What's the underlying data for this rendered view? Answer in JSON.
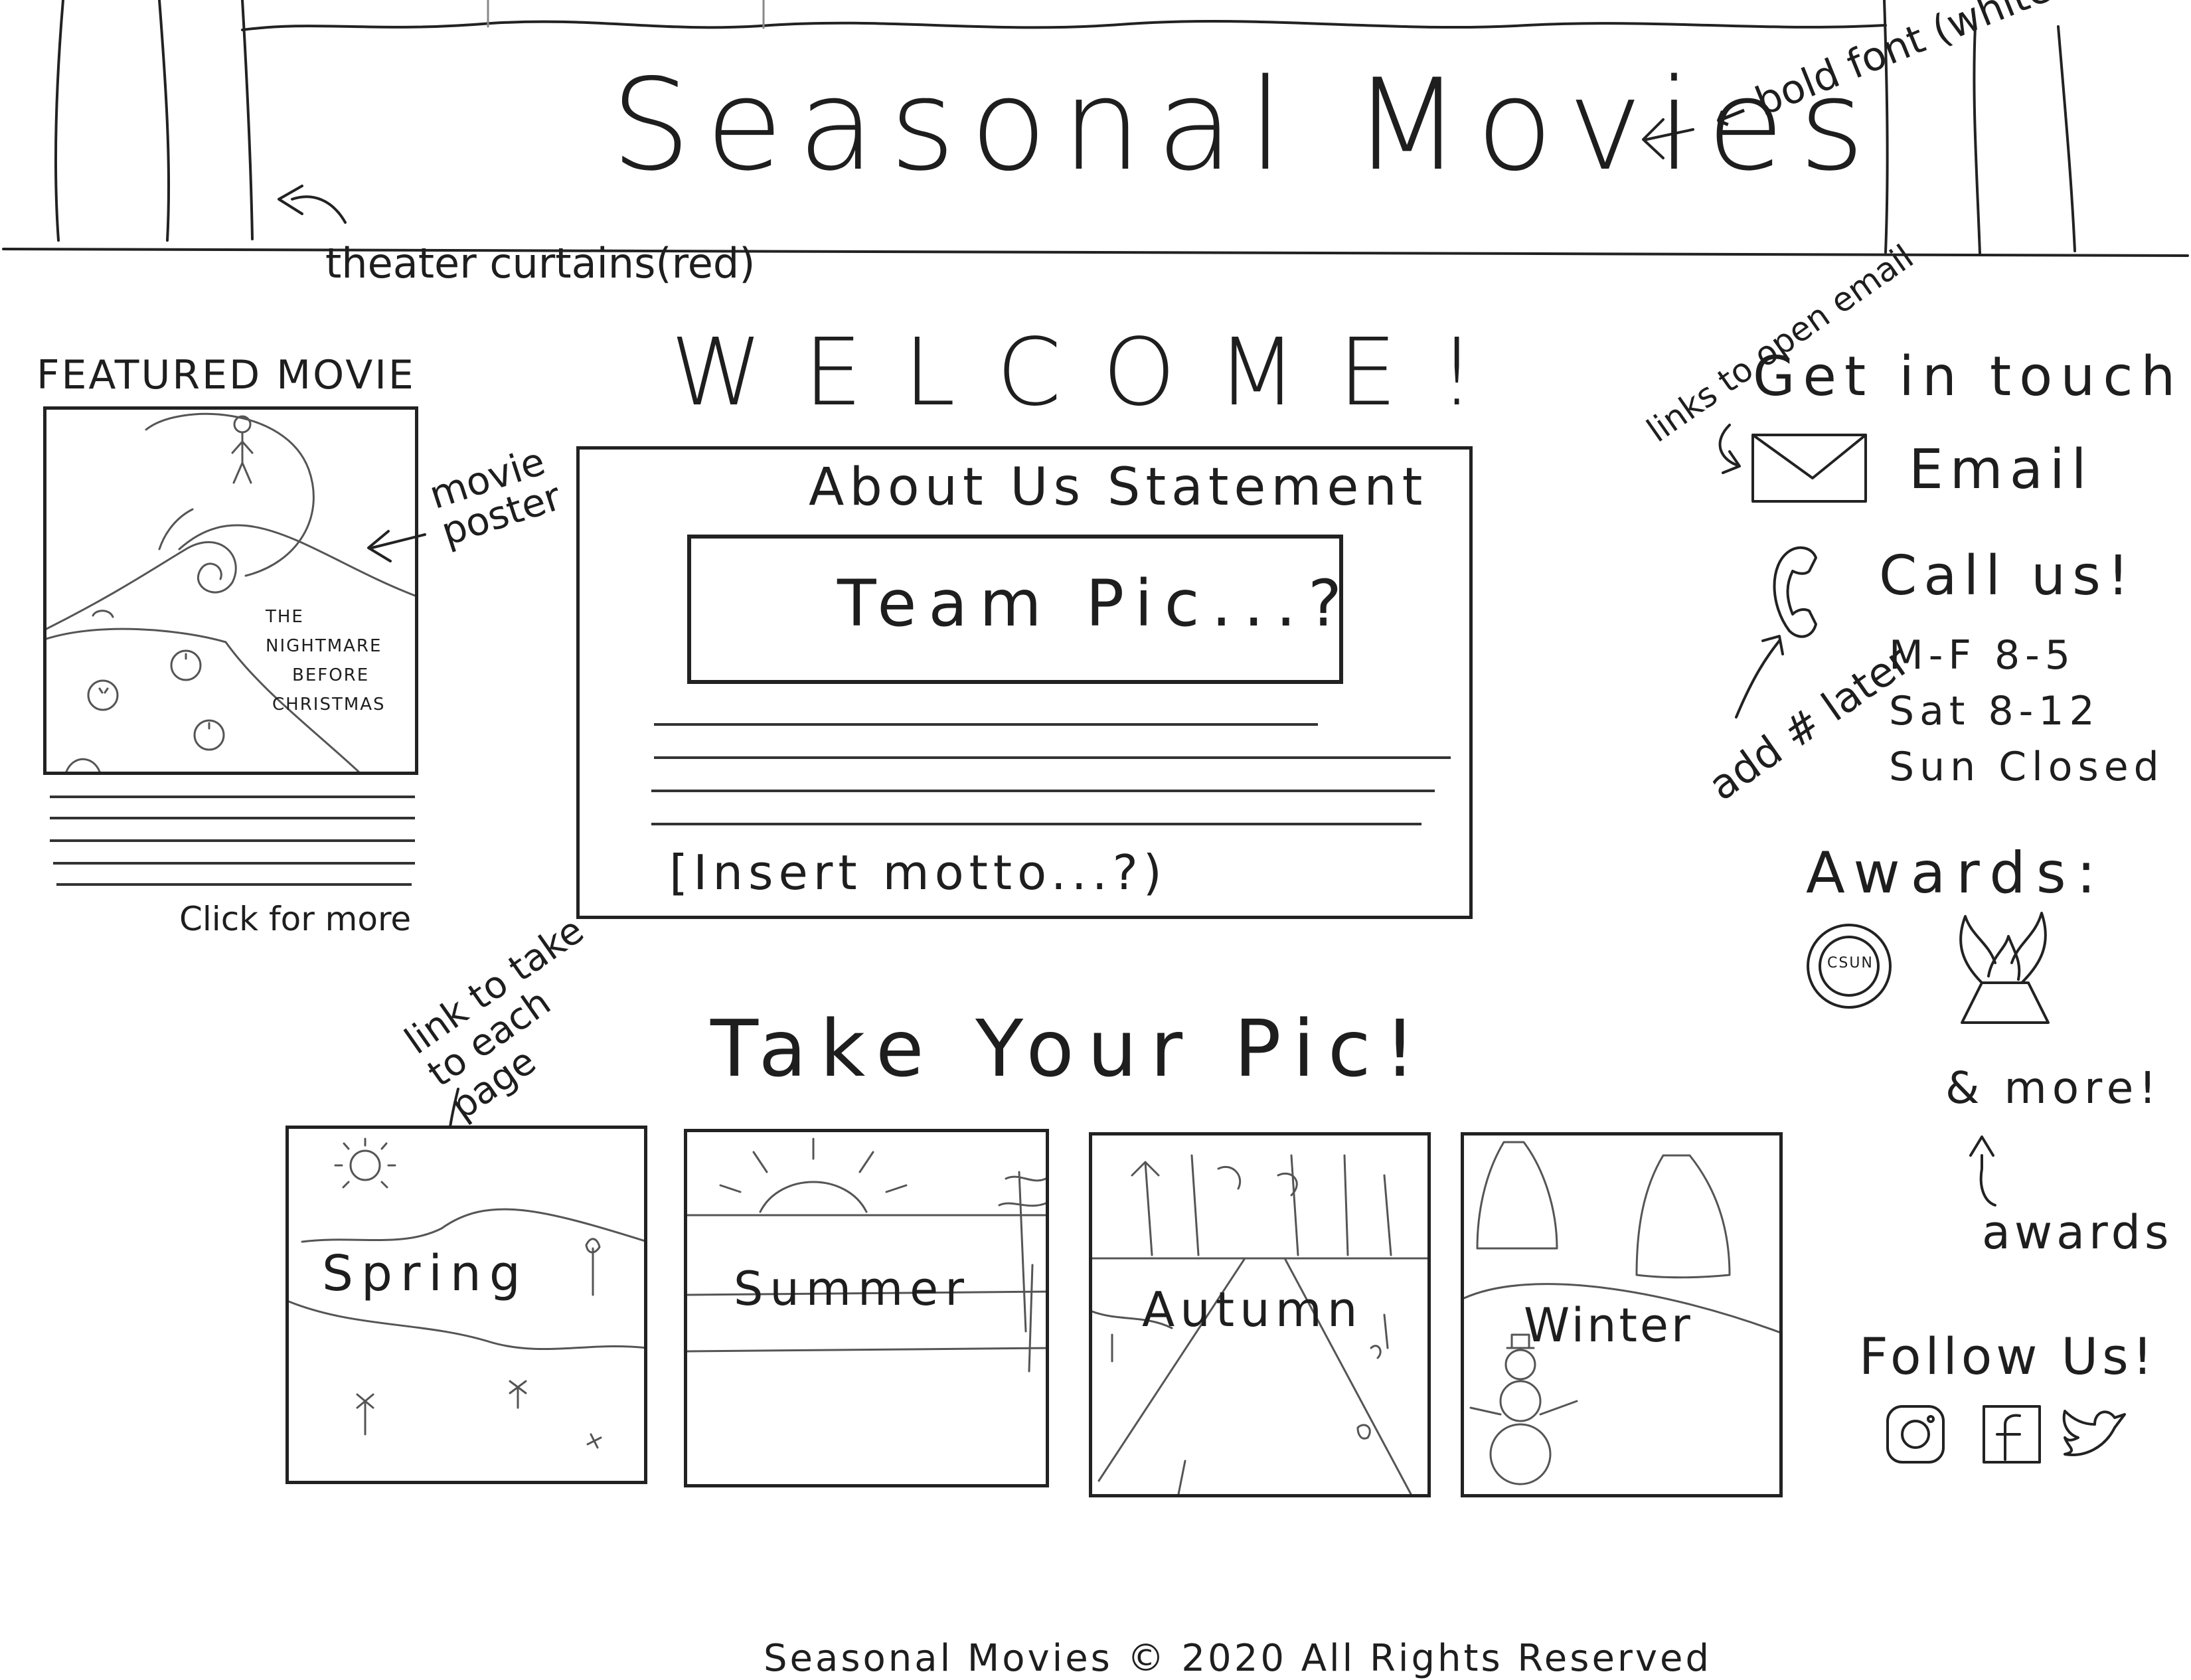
{
  "header": {
    "title": "Seasonal Movies",
    "note_font": "← bold font (white...?)",
    "note_curtains": "theater curtains(red)"
  },
  "featured": {
    "heading": "FEATURED MOVIE",
    "poster_title_lines": [
      "THE",
      "NIGHTMARE",
      "BEFORE",
      "CHRISTMAS"
    ],
    "poster_note": "movie poster",
    "link": "Click for more"
  },
  "welcome": {
    "heading": "WELCOME!",
    "about_title": "About Us Statement",
    "team_pic": "Team Pic...?",
    "motto": "[Insert motto...?)"
  },
  "contact": {
    "note_links": "links to open email",
    "heading": "Get in touch!",
    "email_label": "Email",
    "call_label": "Call us!",
    "hours": [
      "M-F  8-5",
      "Sat  8-12",
      "Sun  Closed"
    ],
    "note_number": "add # later"
  },
  "awards": {
    "heading": "Awards:",
    "badge_text": "CSUN",
    "more": "& more!",
    "note": "awards"
  },
  "seasons": {
    "heading": "Take Your Pic!",
    "note": "link to take to each page",
    "tiles": [
      {
        "label": "Spring"
      },
      {
        "label": "Summer"
      },
      {
        "label": "Autumn"
      },
      {
        "label": "Winter"
      }
    ]
  },
  "social": {
    "heading": "Follow Us!",
    "icons": [
      "instagram-icon",
      "facebook-icon",
      "twitter-icon"
    ]
  },
  "footer": {
    "text": "Seasonal Movies © 2020 All Rights Reserved"
  }
}
